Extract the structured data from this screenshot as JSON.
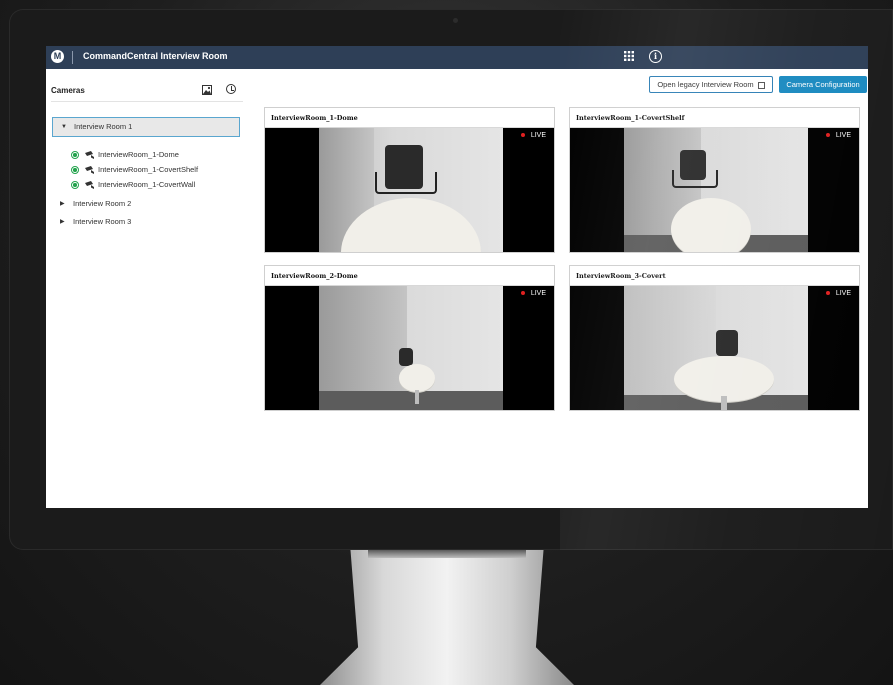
{
  "app": {
    "title": "CommandCentral Interview Room",
    "logo_letter": "M",
    "header_color": "#2e3f57"
  },
  "header_icons": [
    "apps-grid-icon",
    "info-icon"
  ],
  "sidebar": {
    "heading": "Cameras",
    "icons": [
      "snapshot-icon",
      "history-icon"
    ],
    "rooms": [
      {
        "label": "Interview Room 1",
        "expanded": true,
        "selected": true,
        "cameras": [
          {
            "label": "InterviewRoom_1-Dome",
            "status": "online"
          },
          {
            "label": "InterviewRoom_1-CovertShelf",
            "status": "online"
          },
          {
            "label": "InterviewRoom_1-CovertWall",
            "status": "online"
          }
        ]
      },
      {
        "label": "Interview Room 2",
        "expanded": false
      },
      {
        "label": "Interview Room 3",
        "expanded": false
      }
    ]
  },
  "toolbar": {
    "legacy_button": "Open legacy Interview Room",
    "config_button": "Camera Configuration",
    "accent_color": "#1b8ac0"
  },
  "tiles": [
    {
      "name": "InterviewRoom_1-Dome",
      "status": "LIVE"
    },
    {
      "name": "InterviewRoom_1-CovertShelf",
      "status": "LIVE"
    },
    {
      "name": "InterviewRoom_2-Dome",
      "status": "LIVE"
    },
    {
      "name": "InterviewRoom_3-Covert",
      "status": "LIVE"
    }
  ]
}
